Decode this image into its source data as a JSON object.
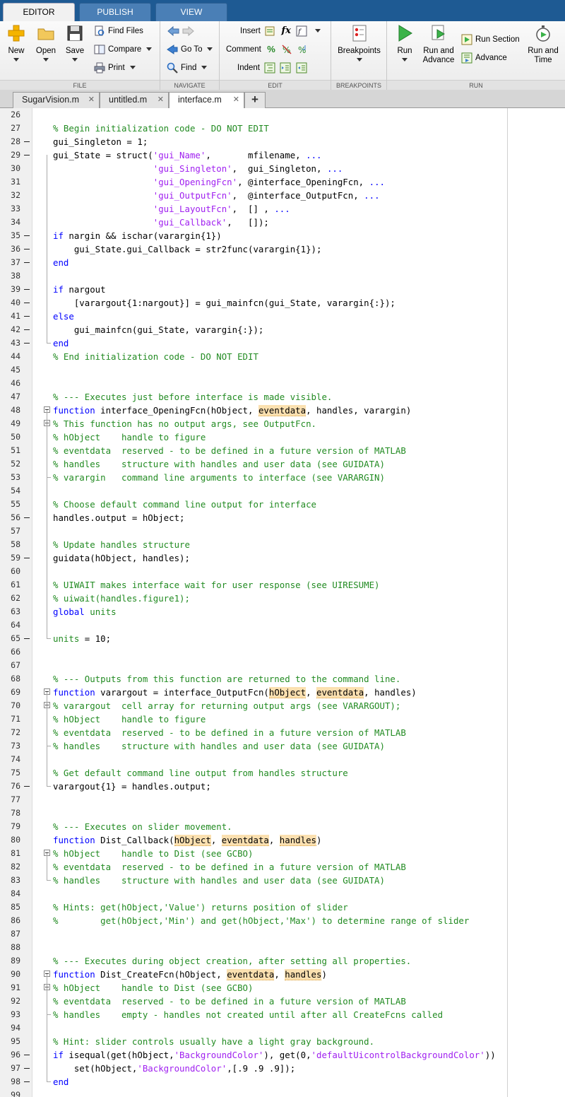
{
  "top_tabs": [
    "EDITOR",
    "PUBLISH",
    "VIEW"
  ],
  "ribbon": {
    "file": {
      "group_label": "FILE",
      "new_label": "New",
      "open_label": "Open",
      "save_label": "Save",
      "find_files_label": "Find Files",
      "compare_label": "Compare",
      "print_label": "Print"
    },
    "navigate": {
      "group_label": "NAVIGATE",
      "goto_label": "Go To",
      "find_label": "Find"
    },
    "edit": {
      "group_label": "EDIT",
      "insert_label": "Insert",
      "comment_label": "Comment",
      "indent_label": "Indent",
      "fx_label": "fx"
    },
    "breakpoints": {
      "group_label": "BREAKPOINTS",
      "breakpoints_label": "Breakpoints"
    },
    "run": {
      "group_label": "RUN",
      "run_label": "Run",
      "run_advance_label_1": "Run and",
      "run_advance_label_2": "Advance",
      "run_section_label": "Run Section",
      "advance_label": "Advance",
      "run_time_label_1": "Run and",
      "run_time_label_2": "Time"
    }
  },
  "file_tabs": [
    {
      "label": "SugarVision.m",
      "close": "✕"
    },
    {
      "label": "untitled.m",
      "close": "✕"
    },
    {
      "label": "interface.m",
      "close": "✕"
    }
  ],
  "add_tab_label": "+",
  "editor_lines": [
    {
      "n": "26",
      "bp": false,
      "fold": "",
      "segs": []
    },
    {
      "n": "27",
      "bp": false,
      "fold": "",
      "segs": [
        {
          "t": "% Begin initialization code - DO NOT EDIT",
          "c": "c"
        }
      ]
    },
    {
      "n": "28",
      "bp": true,
      "fold": "",
      "segs": [
        {
          "t": "gui_Singleton = 1;",
          "c": ""
        }
      ]
    },
    {
      "n": "29",
      "bp": true,
      "fold": "",
      "segs": [
        {
          "t": "gui_State = struct(",
          "c": ""
        },
        {
          "t": "'gui_Name'",
          "c": "s"
        },
        {
          "t": ",       mfilename, ",
          "c": ""
        },
        {
          "t": "...",
          "c": "k"
        }
      ]
    },
    {
      "n": "30",
      "bp": false,
      "fold": "",
      "segs": [
        {
          "t": "                   ",
          "c": ""
        },
        {
          "t": "'gui_Singleton'",
          "c": "s"
        },
        {
          "t": ",  gui_Singleton, ",
          "c": ""
        },
        {
          "t": "...",
          "c": "k"
        }
      ]
    },
    {
      "n": "31",
      "bp": false,
      "fold": "",
      "segs": [
        {
          "t": "                   ",
          "c": ""
        },
        {
          "t": "'gui_OpeningFcn'",
          "c": "s"
        },
        {
          "t": ", @interface_OpeningFcn, ",
          "c": ""
        },
        {
          "t": "...",
          "c": "k"
        }
      ]
    },
    {
      "n": "32",
      "bp": false,
      "fold": "",
      "segs": [
        {
          "t": "                   ",
          "c": ""
        },
        {
          "t": "'gui_OutputFcn'",
          "c": "s"
        },
        {
          "t": ",  @interface_OutputFcn, ",
          "c": ""
        },
        {
          "t": "...",
          "c": "k"
        }
      ]
    },
    {
      "n": "33",
      "bp": false,
      "fold": "",
      "segs": [
        {
          "t": "                   ",
          "c": ""
        },
        {
          "t": "'gui_LayoutFcn'",
          "c": "s"
        },
        {
          "t": ",  [] , ",
          "c": ""
        },
        {
          "t": "...",
          "c": "k"
        }
      ]
    },
    {
      "n": "34",
      "bp": false,
      "fold": "",
      "segs": [
        {
          "t": "                   ",
          "c": ""
        },
        {
          "t": "'gui_Callback'",
          "c": "s"
        },
        {
          "t": ",   []);",
          "c": ""
        }
      ]
    },
    {
      "n": "35",
      "bp": true,
      "fold": "",
      "segs": [
        {
          "t": "if",
          "c": "k"
        },
        {
          "t": " nargin && ischar(varargin{1})",
          "c": ""
        }
      ]
    },
    {
      "n": "36",
      "bp": true,
      "fold": "",
      "segs": [
        {
          "t": "    gui_State.gui_Callback = str2func(varargin{1});",
          "c": ""
        }
      ]
    },
    {
      "n": "37",
      "bp": true,
      "fold": "",
      "segs": [
        {
          "t": "end",
          "c": "k"
        }
      ]
    },
    {
      "n": "38",
      "bp": false,
      "fold": "",
      "segs": []
    },
    {
      "n": "39",
      "bp": true,
      "fold": "",
      "segs": [
        {
          "t": "if",
          "c": "k"
        },
        {
          "t": " nargout",
          "c": ""
        }
      ]
    },
    {
      "n": "40",
      "bp": true,
      "fold": "",
      "segs": [
        {
          "t": "    [varargout{1:nargout}] = gui_mainfcn(gui_State, varargin{:});",
          "c": ""
        }
      ]
    },
    {
      "n": "41",
      "bp": true,
      "fold": "",
      "segs": [
        {
          "t": "else",
          "c": "k"
        }
      ]
    },
    {
      "n": "42",
      "bp": true,
      "fold": "",
      "segs": [
        {
          "t": "    gui_mainfcn(gui_State, varargin{:});",
          "c": ""
        }
      ]
    },
    {
      "n": "43",
      "bp": true,
      "fold": "end",
      "segs": [
        {
          "t": "end",
          "c": "k"
        }
      ]
    },
    {
      "n": "44",
      "bp": false,
      "fold": "",
      "segs": [
        {
          "t": "% End initialization code - DO NOT EDIT",
          "c": "c"
        }
      ]
    },
    {
      "n": "45",
      "bp": false,
      "fold": "",
      "segs": []
    },
    {
      "n": "46",
      "bp": false,
      "fold": "",
      "segs": []
    },
    {
      "n": "47",
      "bp": false,
      "fold": "",
      "segs": [
        {
          "t": "% --- Executes just before interface is made visible.",
          "c": "c"
        }
      ]
    },
    {
      "n": "48",
      "bp": false,
      "fold": "box",
      "segs": [
        {
          "t": "function",
          "c": "k"
        },
        {
          "t": " interface_OpeningFcn(hObject, ",
          "c": ""
        },
        {
          "t": "eventdata",
          "c": "hl"
        },
        {
          "t": ", handles, varargin)",
          "c": ""
        }
      ]
    },
    {
      "n": "49",
      "bp": false,
      "fold": "box",
      "segs": [
        {
          "t": "% This function has no output args, see OutputFcn.",
          "c": "c"
        }
      ]
    },
    {
      "n": "50",
      "bp": false,
      "fold": "",
      "segs": [
        {
          "t": "% hObject    handle to figure",
          "c": "c"
        }
      ]
    },
    {
      "n": "51",
      "bp": false,
      "fold": "",
      "segs": [
        {
          "t": "% eventdata  reserved - to be defined in a future version of MATLAB",
          "c": "c"
        }
      ]
    },
    {
      "n": "52",
      "bp": false,
      "fold": "",
      "segs": [
        {
          "t": "% handles    structure with handles and user data (see GUIDATA)",
          "c": "c"
        }
      ]
    },
    {
      "n": "53",
      "bp": false,
      "fold": "end",
      "segs": [
        {
          "t": "% varargin   command line arguments to interface (see VARARGIN)",
          "c": "c"
        }
      ]
    },
    {
      "n": "54",
      "bp": false,
      "fold": "",
      "segs": []
    },
    {
      "n": "55",
      "bp": false,
      "fold": "",
      "segs": [
        {
          "t": "% Choose default command line output for interface",
          "c": "c"
        }
      ]
    },
    {
      "n": "56",
      "bp": true,
      "fold": "",
      "segs": [
        {
          "t": "handles.output = hObject;",
          "c": ""
        }
      ]
    },
    {
      "n": "57",
      "bp": false,
      "fold": "",
      "segs": []
    },
    {
      "n": "58",
      "bp": false,
      "fold": "",
      "segs": [
        {
          "t": "% Update handles structure",
          "c": "c"
        }
      ]
    },
    {
      "n": "59",
      "bp": true,
      "fold": "",
      "segs": [
        {
          "t": "guidata(hObject, handles);",
          "c": ""
        }
      ]
    },
    {
      "n": "60",
      "bp": false,
      "fold": "",
      "segs": []
    },
    {
      "n": "61",
      "bp": false,
      "fold": "",
      "segs": [
        {
          "t": "% UIWAIT makes interface wait for user response (see UIRESUME)",
          "c": "c"
        }
      ]
    },
    {
      "n": "62",
      "bp": false,
      "fold": "",
      "segs": [
        {
          "t": "% uiwait(handles.figure1);",
          "c": "c"
        }
      ]
    },
    {
      "n": "63",
      "bp": false,
      "fold": "",
      "segs": [
        {
          "t": "global",
          "c": "k"
        },
        {
          "t": " ",
          "c": ""
        },
        {
          "t": "units",
          "c": "c"
        }
      ]
    },
    {
      "n": "64",
      "bp": false,
      "fold": "",
      "segs": []
    },
    {
      "n": "65",
      "bp": true,
      "fold": "end",
      "segs": [
        {
          "t": "units",
          "c": "c"
        },
        {
          "t": " = 10;",
          "c": ""
        }
      ]
    },
    {
      "n": "66",
      "bp": false,
      "fold": "",
      "segs": []
    },
    {
      "n": "67",
      "bp": false,
      "fold": "",
      "segs": []
    },
    {
      "n": "68",
      "bp": false,
      "fold": "",
      "segs": [
        {
          "t": "% --- Outputs from this function are returned to the command line.",
          "c": "c"
        }
      ]
    },
    {
      "n": "69",
      "bp": false,
      "fold": "box",
      "segs": [
        {
          "t": "function",
          "c": "k"
        },
        {
          "t": " varargout = interface_OutputFcn(",
          "c": ""
        },
        {
          "t": "hObject",
          "c": "hl"
        },
        {
          "t": ", ",
          "c": ""
        },
        {
          "t": "eventdata",
          "c": "hl"
        },
        {
          "t": ", handles)",
          "c": ""
        }
      ]
    },
    {
      "n": "70",
      "bp": false,
      "fold": "box",
      "segs": [
        {
          "t": "% varargout  cell array for returning output args (see VARARGOUT);",
          "c": "c"
        }
      ]
    },
    {
      "n": "71",
      "bp": false,
      "fold": "",
      "segs": [
        {
          "t": "% hObject    handle to figure",
          "c": "c"
        }
      ]
    },
    {
      "n": "72",
      "bp": false,
      "fold": "",
      "segs": [
        {
          "t": "% eventdata  reserved - to be defined in a future version of MATLAB",
          "c": "c"
        }
      ]
    },
    {
      "n": "73",
      "bp": false,
      "fold": "end",
      "segs": [
        {
          "t": "% handles    structure with handles and user data (see GUIDATA)",
          "c": "c"
        }
      ]
    },
    {
      "n": "74",
      "bp": false,
      "fold": "",
      "segs": []
    },
    {
      "n": "75",
      "bp": false,
      "fold": "",
      "segs": [
        {
          "t": "% Get default command line output from handles structure",
          "c": "c"
        }
      ]
    },
    {
      "n": "76",
      "bp": true,
      "fold": "end",
      "segs": [
        {
          "t": "varargout{1} = handles.output;",
          "c": ""
        }
      ]
    },
    {
      "n": "77",
      "bp": false,
      "fold": "",
      "segs": []
    },
    {
      "n": "78",
      "bp": false,
      "fold": "",
      "segs": []
    },
    {
      "n": "79",
      "bp": false,
      "fold": "",
      "segs": [
        {
          "t": "% --- Executes on slider movement.",
          "c": "c"
        }
      ]
    },
    {
      "n": "80",
      "bp": false,
      "fold": "",
      "segs": [
        {
          "t": "function",
          "c": "k"
        },
        {
          "t": " Dist_Callback(",
          "c": ""
        },
        {
          "t": "hObject",
          "c": "hl"
        },
        {
          "t": ", ",
          "c": ""
        },
        {
          "t": "eventdata",
          "c": "hl"
        },
        {
          "t": ", ",
          "c": ""
        },
        {
          "t": "handles",
          "c": "hl"
        },
        {
          "t": ")",
          "c": ""
        }
      ]
    },
    {
      "n": "81",
      "bp": false,
      "fold": "box",
      "segs": [
        {
          "t": "% hObject    handle to Dist (see GCBO)",
          "c": "c"
        }
      ]
    },
    {
      "n": "82",
      "bp": false,
      "fold": "",
      "segs": [
        {
          "t": "% eventdata  reserved - to be defined in a future version of MATLAB",
          "c": "c"
        }
      ]
    },
    {
      "n": "83",
      "bp": false,
      "fold": "end",
      "segs": [
        {
          "t": "% handles    structure with handles and user data (see GUIDATA)",
          "c": "c"
        }
      ]
    },
    {
      "n": "84",
      "bp": false,
      "fold": "",
      "segs": []
    },
    {
      "n": "85",
      "bp": false,
      "fold": "",
      "segs": [
        {
          "t": "% Hints: get(hObject,'Value') returns position of slider",
          "c": "c"
        }
      ]
    },
    {
      "n": "86",
      "bp": false,
      "fold": "",
      "segs": [
        {
          "t": "%        get(hObject,'Min') and get(hObject,'Max') to determine range of slider",
          "c": "c"
        }
      ]
    },
    {
      "n": "87",
      "bp": false,
      "fold": "",
      "segs": []
    },
    {
      "n": "88",
      "bp": false,
      "fold": "",
      "segs": []
    },
    {
      "n": "89",
      "bp": false,
      "fold": "",
      "segs": [
        {
          "t": "% --- Executes during object creation, after setting all properties.",
          "c": "c"
        }
      ]
    },
    {
      "n": "90",
      "bp": false,
      "fold": "box",
      "segs": [
        {
          "t": "function",
          "c": "k"
        },
        {
          "t": " Dist_CreateFcn(hObject, ",
          "c": ""
        },
        {
          "t": "eventdata",
          "c": "hl"
        },
        {
          "t": ", ",
          "c": ""
        },
        {
          "t": "handles",
          "c": "hl"
        },
        {
          "t": ")",
          "c": ""
        }
      ]
    },
    {
      "n": "91",
      "bp": false,
      "fold": "box",
      "segs": [
        {
          "t": "% hObject    handle to Dist (see GCBO)",
          "c": "c"
        }
      ]
    },
    {
      "n": "92",
      "bp": false,
      "fold": "",
      "segs": [
        {
          "t": "% eventdata  reserved - to be defined in a future version of MATLAB",
          "c": "c"
        }
      ]
    },
    {
      "n": "93",
      "bp": false,
      "fold": "end",
      "segs": [
        {
          "t": "% handles    empty - handles not created until after all CreateFcns called",
          "c": "c"
        }
      ]
    },
    {
      "n": "94",
      "bp": false,
      "fold": "",
      "segs": []
    },
    {
      "n": "95",
      "bp": false,
      "fold": "",
      "segs": [
        {
          "t": "% Hint: slider controls usually have a light gray background.",
          "c": "c"
        }
      ]
    },
    {
      "n": "96",
      "bp": true,
      "fold": "",
      "segs": [
        {
          "t": "if",
          "c": "k"
        },
        {
          "t": " isequal(get(hObject,",
          "c": ""
        },
        {
          "t": "'BackgroundColor'",
          "c": "s"
        },
        {
          "t": "), get(0,",
          "c": ""
        },
        {
          "t": "'defaultUicontrolBackgroundColor'",
          "c": "s"
        },
        {
          "t": "))",
          "c": ""
        }
      ]
    },
    {
      "n": "97",
      "bp": true,
      "fold": "",
      "segs": [
        {
          "t": "    set(hObject,",
          "c": ""
        },
        {
          "t": "'BackgroundColor'",
          "c": "s"
        },
        {
          "t": ",[.9 .9 .9]);",
          "c": ""
        }
      ]
    },
    {
      "n": "98",
      "bp": true,
      "fold": "end",
      "segs": [
        {
          "t": "end",
          "c": "k"
        }
      ]
    },
    {
      "n": "99",
      "bp": false,
      "fold": "",
      "segs": []
    }
  ]
}
